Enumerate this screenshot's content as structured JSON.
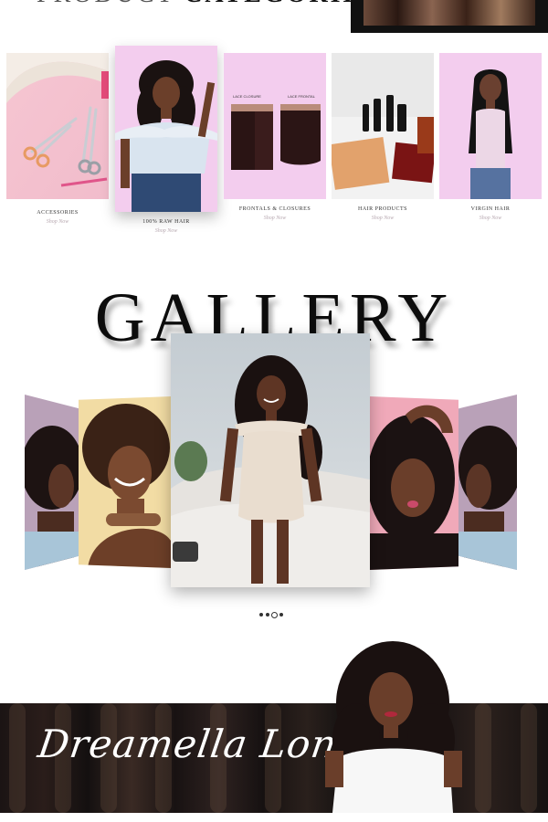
{
  "header": {
    "heading_light": "PRODUCT",
    "heading_bold": "CATEGORIES"
  },
  "categories": [
    {
      "name": "ACCESSORIES",
      "link": "Shop Now"
    },
    {
      "name": "100% RAW HAIR",
      "link": "Shop Now"
    },
    {
      "name": "FRONTALS & CLOSURES",
      "link": "Shop Now",
      "label_closure": "LACE CLOSURE",
      "label_frontal": "LACE FRONTAL"
    },
    {
      "name": "HAIR PRODUCTS",
      "link": "Shop Now"
    },
    {
      "name": "VIRGIN HAIR",
      "link": "Shop Now"
    }
  ],
  "gallery": {
    "title": "GALLERY",
    "dots": 3,
    "active_dot": 2
  },
  "brand": {
    "name": "Dreamella London"
  },
  "colors": {
    "pink_bg": "#f3cdee",
    "dark": "#111111"
  }
}
